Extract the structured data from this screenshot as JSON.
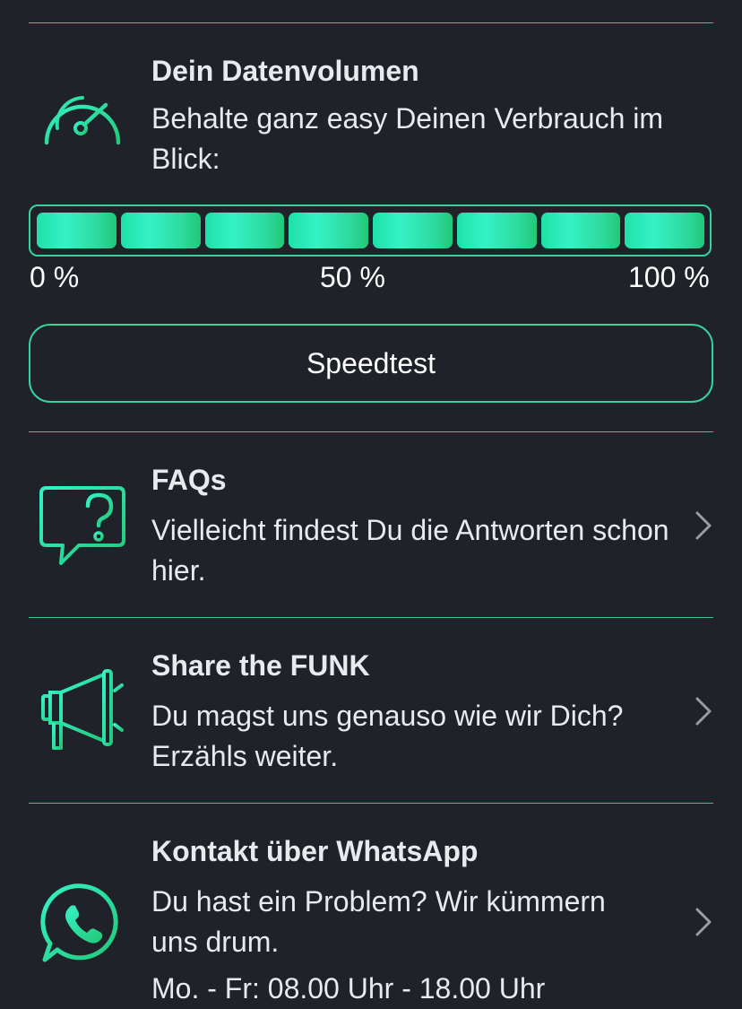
{
  "colors": {
    "background": "#1f2229",
    "accent": "#35d49c",
    "accent_light": "#35f2c6",
    "text": "#e9eaee"
  },
  "data_volume": {
    "icon": "speedometer-icon",
    "title": "Dein Datenvolumen",
    "description": "Behalte ganz easy Deinen Verbrauch im Blick:",
    "usage_fraction": 1.0,
    "segments": 8,
    "label_min": "0 %",
    "label_mid": "50 %",
    "label_max": "100 %",
    "speedtest_label": "Speedtest"
  },
  "items": [
    {
      "icon": "faq-chat-icon",
      "title": "FAQs",
      "description": "Vielleicht findest Du die Antworten schon hier."
    },
    {
      "icon": "megaphone-icon",
      "title": "Share the FUNK",
      "description": "Du magst uns genauso wie wir Dich? Erzähls weiter."
    },
    {
      "icon": "whatsapp-icon",
      "title": "Kontakt über WhatsApp",
      "description": "Du hast ein Problem? Wir kümmern uns drum.",
      "hours": "Mo. - Fr: 08.00 Uhr - 18.00 Uhr"
    }
  ]
}
